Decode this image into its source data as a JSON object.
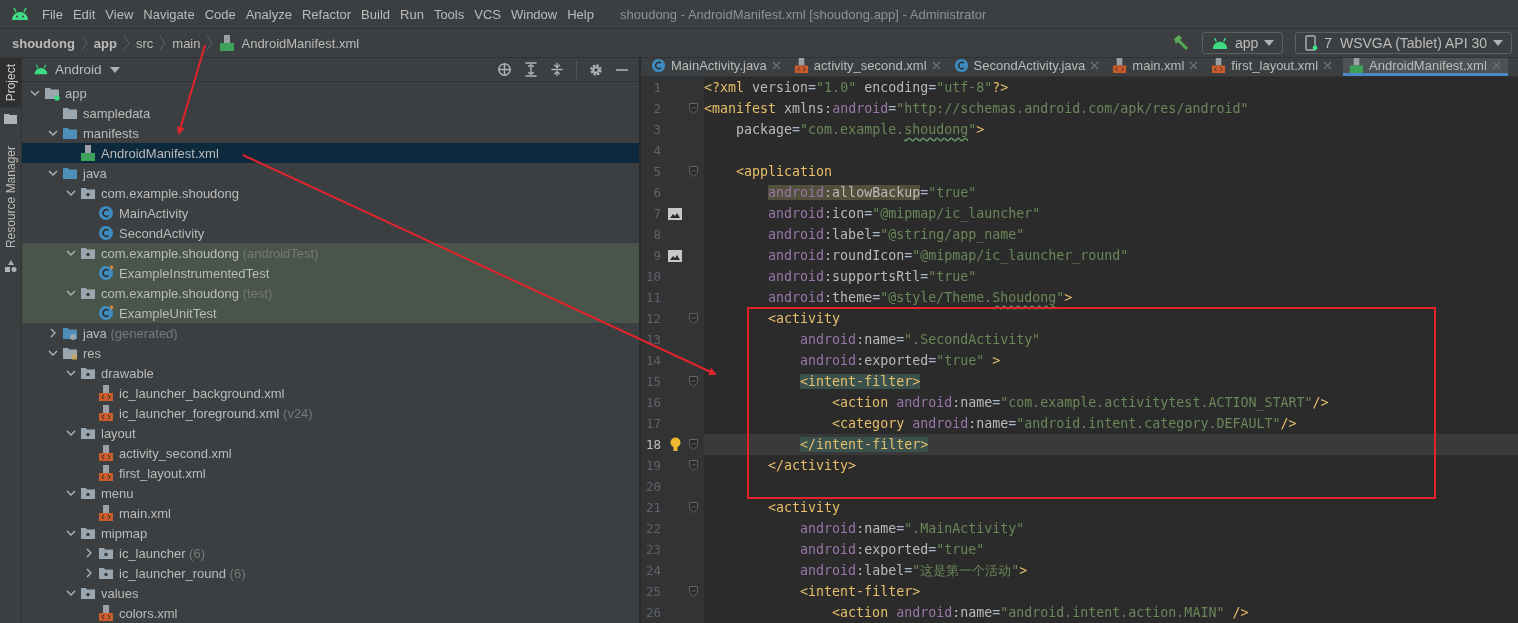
{
  "menu_bar": {
    "items": [
      "File",
      "Edit",
      "View",
      "Navigate",
      "Code",
      "Analyze",
      "Refactor",
      "Build",
      "Run",
      "Tools",
      "VCS",
      "Window",
      "Help"
    ],
    "title": "shoudong - AndroidManifest.xml [shoudong.app] - Administrator"
  },
  "navigation_bar": {
    "breadcrumbs": [
      {
        "label": "shoudong",
        "kind": "bold"
      },
      {
        "label": "app",
        "kind": "bold"
      },
      {
        "label": "src",
        "kind": "plain"
      },
      {
        "label": "main",
        "kind": "plain"
      },
      {
        "label": "AndroidManifest.xml",
        "kind": "manifest"
      }
    ],
    "run_config": "app",
    "device": "7  WSVGA (Tablet) API 30"
  },
  "tool_strip": [
    {
      "label": "Project",
      "selected": true
    },
    {
      "label": "Resource Manager",
      "selected": false
    }
  ],
  "project": {
    "view": "Android",
    "tree": [
      {
        "label": "app",
        "kind": "module",
        "expanded": true,
        "selected": false,
        "test_source": false,
        "children": [
          {
            "label": "sampledata",
            "kind": "folder",
            "selected": false,
            "test_source": false
          },
          {
            "label": "manifests",
            "kind": "source-folder",
            "expanded": true,
            "selected": false,
            "test_source": false,
            "children": [
              {
                "label": "AndroidManifest.xml",
                "kind": "manifest",
                "selected": true,
                "test_source": false
              }
            ]
          },
          {
            "label": "java",
            "kind": "source-folder",
            "expanded": true,
            "selected": false,
            "test_source": false,
            "children": [
              {
                "label": "com.example.shoudong",
                "kind": "package",
                "expanded": true,
                "selected": false,
                "test_source": false,
                "children": [
                  {
                    "label": "MainActivity",
                    "kind": "class",
                    "selected": false,
                    "test_source": false
                  },
                  {
                    "label": "SecondActivity",
                    "kind": "class",
                    "selected": false,
                    "test_source": false
                  }
                ]
              },
              {
                "label": "com.example.shoudong",
                "hint": "(androidTest)",
                "kind": "package",
                "expanded": true,
                "selected": false,
                "test_source": true,
                "children": [
                  {
                    "label": "ExampleInstrumentedTest",
                    "kind": "test-class",
                    "selected": false,
                    "test_source": true
                  }
                ]
              },
              {
                "label": "com.example.shoudong",
                "hint": "(test)",
                "kind": "package",
                "expanded": true,
                "selected": false,
                "test_source": true,
                "children": [
                  {
                    "label": "ExampleUnitTest",
                    "kind": "test-class",
                    "selected": false,
                    "test_source": true
                  }
                ]
              }
            ]
          },
          {
            "label": "java",
            "hint": "(generated)",
            "kind": "generated-folder",
            "expanded": false,
            "selected": false,
            "test_source": false
          },
          {
            "label": "res",
            "kind": "res-folder",
            "expanded": true,
            "selected": false,
            "test_source": false,
            "children": [
              {
                "label": "drawable",
                "kind": "package",
                "expanded": true,
                "selected": false,
                "test_source": false,
                "children": [
                  {
                    "label": "ic_launcher_background.xml",
                    "kind": "xml",
                    "selected": false,
                    "test_source": false
                  },
                  {
                    "label": "ic_launcher_foreground.xml",
                    "hint": "(v24)",
                    "kind": "xml",
                    "selected": false,
                    "test_source": false
                  }
                ]
              },
              {
                "label": "layout",
                "kind": "package",
                "expanded": true,
                "selected": false,
                "test_source": false,
                "children": [
                  {
                    "label": "activity_second.xml",
                    "kind": "xml",
                    "selected": false,
                    "test_source": false
                  },
                  {
                    "label": "first_layout.xml",
                    "kind": "xml",
                    "selected": false,
                    "test_source": false
                  }
                ]
              },
              {
                "label": "menu",
                "kind": "package",
                "expanded": true,
                "selected": false,
                "test_source": false,
                "children": [
                  {
                    "label": "main.xml",
                    "kind": "xml",
                    "selected": false,
                    "test_source": false
                  }
                ]
              },
              {
                "label": "mipmap",
                "kind": "package",
                "expanded": true,
                "selected": false,
                "test_source": false,
                "children": [
                  {
                    "label": "ic_launcher",
                    "hint": "(6)",
                    "kind": "package",
                    "expanded": false,
                    "selected": false,
                    "test_source": false
                  },
                  {
                    "label": "ic_launcher_round",
                    "hint": "(6)",
                    "kind": "package",
                    "expanded": false,
                    "selected": false,
                    "test_source": false
                  }
                ]
              },
              {
                "label": "values",
                "kind": "package",
                "expanded": true,
                "selected": false,
                "test_source": false,
                "children": [
                  {
                    "label": "colors.xml",
                    "kind": "xml",
                    "selected": false,
                    "test_source": false
                  }
                ]
              }
            ]
          }
        ]
      }
    ]
  },
  "editor": {
    "tabs": [
      {
        "label": "MainActivity.java",
        "kind": "class",
        "selected": false
      },
      {
        "label": "activity_second.xml",
        "kind": "xml",
        "selected": false
      },
      {
        "label": "SecondActivity.java",
        "kind": "class",
        "selected": false
      },
      {
        "label": "main.xml",
        "kind": "xml",
        "selected": false
      },
      {
        "label": "first_layout.xml",
        "kind": "xml",
        "selected": false
      },
      {
        "label": "AndroidManifest.xml",
        "kind": "manifest",
        "selected": true
      }
    ],
    "lines": [
      {
        "num": "1",
        "fold": false,
        "current": false,
        "tokens": [
          {
            "kind": "tag",
            "text": "<?xml"
          },
          {
            "kind": "attr",
            "text": " version"
          },
          {
            "kind": "punct",
            "text": "="
          },
          {
            "kind": "value",
            "text": "\"1.0\""
          },
          {
            "kind": "attr",
            "text": " encoding"
          },
          {
            "kind": "punct",
            "text": "="
          },
          {
            "kind": "value",
            "text": "\"utf-8\""
          },
          {
            "kind": "tag",
            "text": "?>"
          }
        ]
      },
      {
        "num": "2",
        "fold": true,
        "current": false,
        "tokens": [
          {
            "kind": "tag",
            "text": "<manifest"
          },
          {
            "kind": "attr",
            "text": " xmlns"
          },
          {
            "kind": "punct",
            "text": ":"
          },
          {
            "kind": "ns",
            "text": "android"
          },
          {
            "kind": "punct",
            "text": "="
          },
          {
            "kind": "value",
            "text": "\"http://schemas.android.com/apk/res/android\""
          }
        ]
      },
      {
        "num": "3",
        "fold": false,
        "current": false,
        "tokens": [
          {
            "kind": "attr",
            "text": "    package"
          },
          {
            "kind": "punct",
            "text": "="
          },
          {
            "kind": "value",
            "text": "\"com.example."
          },
          {
            "kind": "typo",
            "text": "shoudong"
          },
          {
            "kind": "value",
            "text": "\""
          },
          {
            "kind": "tag",
            "text": ">"
          }
        ]
      },
      {
        "num": "4",
        "fold": false,
        "current": false
      },
      {
        "num": "5",
        "fold": true,
        "current": false,
        "tokens": [
          {
            "kind": "tag",
            "text": "    <application"
          }
        ]
      },
      {
        "num": "6",
        "fold": false,
        "current": false,
        "tokens": [
          {
            "kind": "nsmark",
            "text": "        android"
          },
          {
            "kind": "punctmark",
            "text": ":"
          },
          {
            "kind": "attrmark",
            "text": "allowBackup"
          },
          {
            "kind": "punct",
            "text": "="
          },
          {
            "kind": "value",
            "text": "\"true\""
          }
        ]
      },
      {
        "num": "7",
        "fold": false,
        "current": false,
        "gutter": {
          "kind": "image"
        },
        "tokens": [
          {
            "kind": "ns",
            "text": "        android"
          },
          {
            "kind": "punct",
            "text": ":"
          },
          {
            "kind": "attr",
            "text": "icon"
          },
          {
            "kind": "punct",
            "text": "="
          },
          {
            "kind": "value",
            "text": "\"@mipmap/ic_launcher\""
          }
        ]
      },
      {
        "num": "8",
        "fold": false,
        "current": false,
        "tokens": [
          {
            "kind": "ns",
            "text": "        android"
          },
          {
            "kind": "punct",
            "text": ":"
          },
          {
            "kind": "attr",
            "text": "label"
          },
          {
            "kind": "punct",
            "text": "="
          },
          {
            "kind": "value",
            "text": "\"@string/app_name\""
          }
        ]
      },
      {
        "num": "9",
        "fold": false,
        "current": false,
        "gutter": {
          "kind": "image"
        },
        "tokens": [
          {
            "kind": "ns",
            "text": "        android"
          },
          {
            "kind": "punct",
            "text": ":"
          },
          {
            "kind": "attr",
            "text": "roundIcon"
          },
          {
            "kind": "punct",
            "text": "="
          },
          {
            "kind": "value",
            "text": "\"@mipmap/ic_launcher_round\""
          }
        ]
      },
      {
        "num": "10",
        "fold": false,
        "current": false,
        "tokens": [
          {
            "kind": "ns",
            "text": "        android"
          },
          {
            "kind": "punct",
            "text": ":"
          },
          {
            "kind": "attr",
            "text": "supportsRtl"
          },
          {
            "kind": "punct",
            "text": "="
          },
          {
            "kind": "value",
            "text": "\"true\""
          }
        ]
      },
      {
        "num": "11",
        "fold": false,
        "current": false,
        "tokens": [
          {
            "kind": "ns",
            "text": "        android"
          },
          {
            "kind": "punct",
            "text": ":"
          },
          {
            "kind": "attr",
            "text": "theme"
          },
          {
            "kind": "punct",
            "text": "="
          },
          {
            "kind": "value",
            "text": "\"@style/Theme."
          },
          {
            "kind": "typo",
            "text": "Shoudong"
          },
          {
            "kind": "value",
            "text": "\""
          },
          {
            "kind": "tag",
            "text": ">"
          }
        ]
      },
      {
        "num": "12",
        "fold": true,
        "current": false,
        "tokens": [
          {
            "kind": "tag",
            "text": "        <activity"
          }
        ]
      },
      {
        "num": "13",
        "fold": false,
        "current": false,
        "tokens": [
          {
            "kind": "ns",
            "text": "            android"
          },
          {
            "kind": "punct",
            "text": ":"
          },
          {
            "kind": "attr",
            "text": "name"
          },
          {
            "kind": "punct",
            "text": "="
          },
          {
            "kind": "value",
            "text": "\".SecondActivity\""
          }
        ]
      },
      {
        "num": "14",
        "fold": false,
        "current": false,
        "tokens": [
          {
            "kind": "ns",
            "text": "            android"
          },
          {
            "kind": "punct",
            "text": ":"
          },
          {
            "kind": "attr",
            "text": "exported"
          },
          {
            "kind": "punct",
            "text": "="
          },
          {
            "kind": "value",
            "text": "\"true\""
          },
          {
            "kind": "tag",
            "text": " >"
          }
        ]
      },
      {
        "num": "15",
        "fold": true,
        "current": false,
        "tokens": [
          {
            "kind": "tagmark",
            "text": "            <intent-filter>"
          }
        ]
      },
      {
        "num": "16",
        "fold": false,
        "current": false,
        "tokens": [
          {
            "kind": "tag",
            "text": "                <action "
          },
          {
            "kind": "ns",
            "text": "android"
          },
          {
            "kind": "punct",
            "text": ":"
          },
          {
            "kind": "attr",
            "text": "name"
          },
          {
            "kind": "punct",
            "text": "="
          },
          {
            "kind": "value",
            "text": "\"com.example.activitytest.ACTION_START\""
          },
          {
            "kind": "tag",
            "text": "/>"
          }
        ]
      },
      {
        "num": "17",
        "fold": false,
        "current": false,
        "tokens": [
          {
            "kind": "tag",
            "text": "                <category "
          },
          {
            "kind": "ns",
            "text": "android"
          },
          {
            "kind": "punct",
            "text": ":"
          },
          {
            "kind": "attr",
            "text": "name"
          },
          {
            "kind": "punct",
            "text": "="
          },
          {
            "kind": "value",
            "text": "\"android.intent.category.DEFAULT\""
          },
          {
            "kind": "tag",
            "text": "/>"
          }
        ]
      },
      {
        "num": "18",
        "fold": true,
        "current": true,
        "gutter": {
          "kind": "bulb"
        },
        "tokens": [
          {
            "kind": "tagmark",
            "text": "            </intent-filter>"
          }
        ]
      },
      {
        "num": "19",
        "fold": true,
        "current": false,
        "tokens": [
          {
            "kind": "tag",
            "text": "        </activity>"
          }
        ]
      },
      {
        "num": "20",
        "fold": false,
        "current": false
      },
      {
        "num": "21",
        "fold": true,
        "current": false,
        "tokens": [
          {
            "kind": "tag",
            "text": "        <activity"
          }
        ]
      },
      {
        "num": "22",
        "fold": false,
        "current": false,
        "tokens": [
          {
            "kind": "ns",
            "text": "            android"
          },
          {
            "kind": "punct",
            "text": ":"
          },
          {
            "kind": "attr",
            "text": "name"
          },
          {
            "kind": "punct",
            "text": "="
          },
          {
            "kind": "value",
            "text": "\".MainActivity\""
          }
        ]
      },
      {
        "num": "23",
        "fold": false,
        "current": false,
        "tokens": [
          {
            "kind": "ns",
            "text": "            android"
          },
          {
            "kind": "punct",
            "text": ":"
          },
          {
            "kind": "attr",
            "text": "exported"
          },
          {
            "kind": "punct",
            "text": "="
          },
          {
            "kind": "value",
            "text": "\"true\""
          }
        ]
      },
      {
        "num": "24",
        "fold": false,
        "current": false,
        "tokens": [
          {
            "kind": "ns",
            "text": "            android"
          },
          {
            "kind": "punct",
            "text": ":"
          },
          {
            "kind": "attr",
            "text": "label"
          },
          {
            "kind": "punct",
            "text": "="
          },
          {
            "kind": "value",
            "text": "\"这是第一个活动\""
          },
          {
            "kind": "tag",
            "text": ">"
          }
        ]
      },
      {
        "num": "25",
        "fold": true,
        "current": false,
        "tokens": [
          {
            "kind": "tag",
            "text": "            <intent-filter>"
          }
        ]
      },
      {
        "num": "26",
        "fold": false,
        "current": false,
        "tokens": [
          {
            "kind": "tag",
            "text": "                <action "
          },
          {
            "kind": "ns",
            "text": "android"
          },
          {
            "kind": "punct",
            "text": ":"
          },
          {
            "kind": "attr",
            "text": "name"
          },
          {
            "kind": "punct",
            "text": "="
          },
          {
            "kind": "value",
            "text": "\"android.intent.action.MAIN\""
          },
          {
            "kind": "tag",
            "text": " />"
          }
        ]
      }
    ]
  }
}
